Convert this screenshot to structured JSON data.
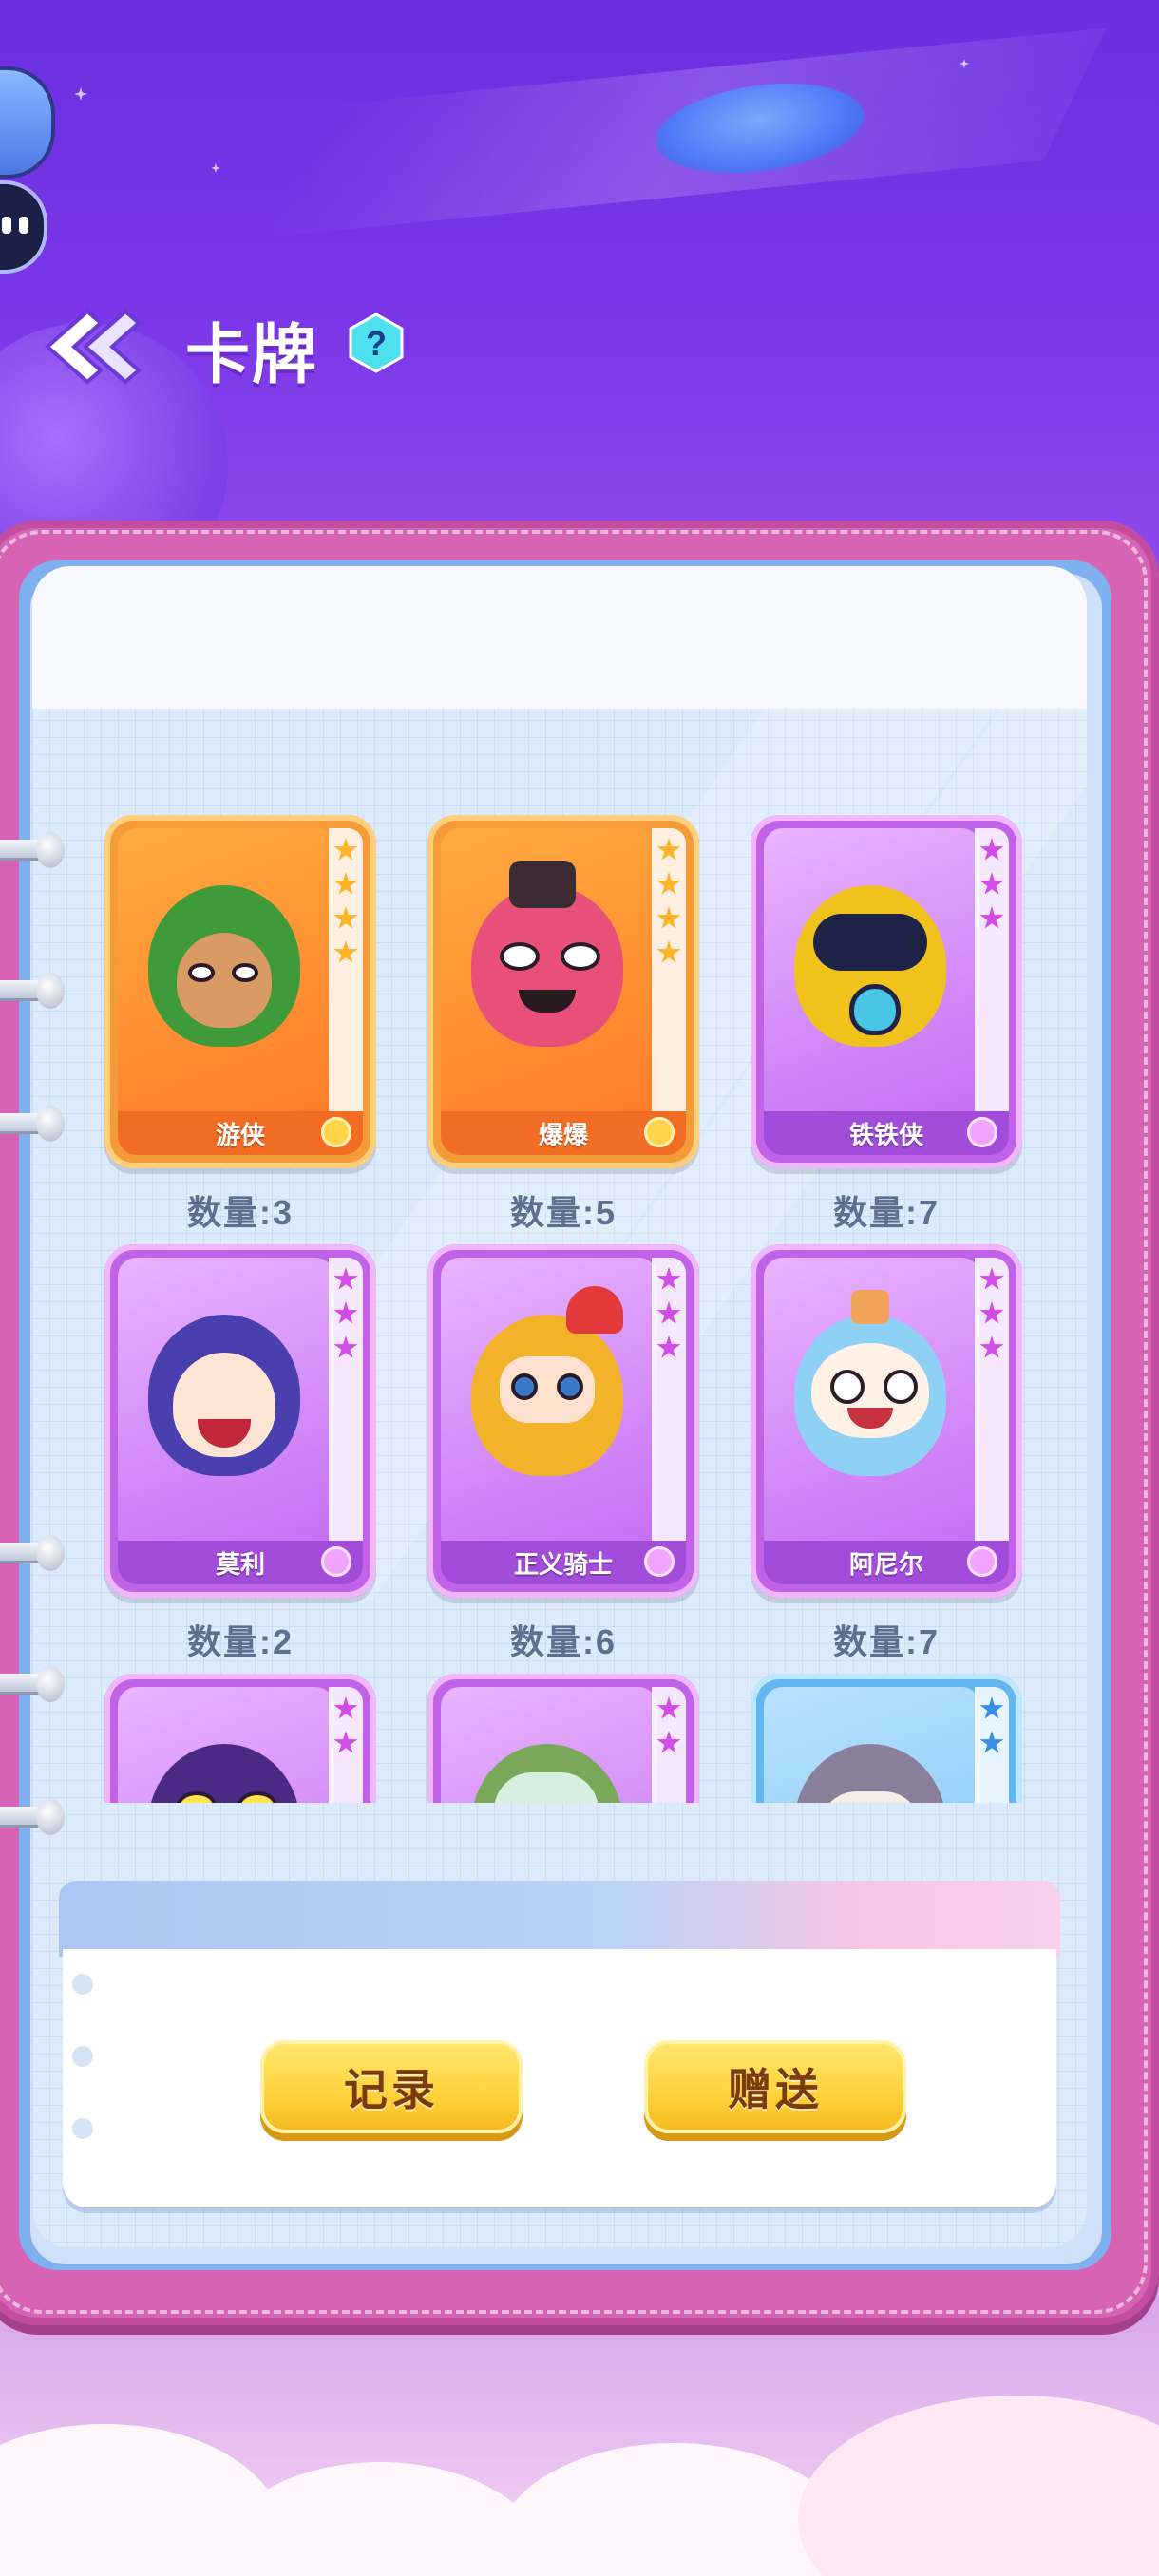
{
  "header": {
    "title": "卡牌",
    "help_icon": "question-icon",
    "back_icon": "double-chevron-left-icon"
  },
  "cards": [
    {
      "name": "游侠",
      "count_label": "数量:3",
      "rarity": "orange",
      "stars": 4
    },
    {
      "name": "爆爆",
      "count_label": "数量:5",
      "rarity": "orange",
      "stars": 4
    },
    {
      "name": "铁铁侠",
      "count_label": "数量:7",
      "rarity": "purple",
      "stars": 3
    },
    {
      "name": "莫利",
      "count_label": "数量:2",
      "rarity": "purple",
      "stars": 3
    },
    {
      "name": "正义骑士",
      "count_label": "数量:6",
      "rarity": "purple",
      "stars": 3
    },
    {
      "name": "阿尼尔",
      "count_label": "数量:7",
      "rarity": "purple",
      "stars": 3
    },
    {
      "name": "",
      "count_label": "",
      "rarity": "purple",
      "stars": 2
    },
    {
      "name": "",
      "count_label": "",
      "rarity": "purple",
      "stars": 2
    },
    {
      "name": "",
      "count_label": "",
      "rarity": "blue",
      "stars": 2
    }
  ],
  "actions": {
    "record_label": "记录",
    "gift_label": "赠送"
  },
  "colors": {
    "orange_card": "#f59b3a",
    "purple_card": "#c063e8",
    "blue_card": "#63b6ef",
    "button": "#ffd23a",
    "button_text": "#7a3c0c"
  }
}
